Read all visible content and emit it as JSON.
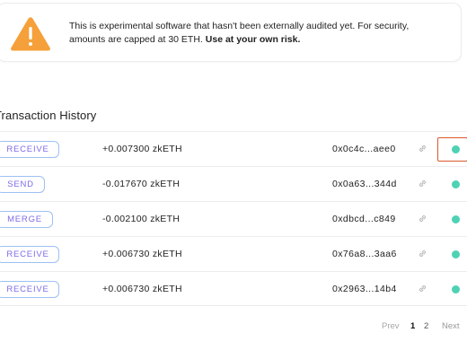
{
  "warning": {
    "icon": "warning-triangle-icon",
    "icon_color": "#f5a03a",
    "message": "This is experimental software that hasn't been externally audited yet. For security, amounts are capped at 30 ETH.",
    "emphasis": "Use at your own risk."
  },
  "transactions": {
    "title": "Transaction History",
    "rows": [
      {
        "type": "RECEIVE",
        "amount": "+0.007300 zkETH",
        "hash": "0x0c4c...aee0",
        "status": "confirmed"
      },
      {
        "type": "SEND",
        "amount": "-0.017670 zkETH",
        "hash": "0x0a63...344d",
        "status": "confirmed"
      },
      {
        "type": "MERGE",
        "amount": "-0.002100 zkETH",
        "hash": "0xdbcd...c849",
        "status": "confirmed"
      },
      {
        "type": "RECEIVE",
        "amount": "+0.006730 zkETH",
        "hash": "0x76a8...3aa6",
        "status": "confirmed"
      },
      {
        "type": "RECEIVE",
        "amount": "+0.006730 zkETH",
        "hash": "0x2963...14b4",
        "status": "confirmed"
      }
    ],
    "status_color": "#4fd1b4",
    "badge_border_color": "#9cc0f2",
    "badge_text_color": "#7b6ce8",
    "highlight_color": "#d9582b"
  },
  "pagination": {
    "prev": "Prev",
    "pages": [
      "1",
      "2"
    ],
    "current": "1",
    "next": "Next"
  }
}
